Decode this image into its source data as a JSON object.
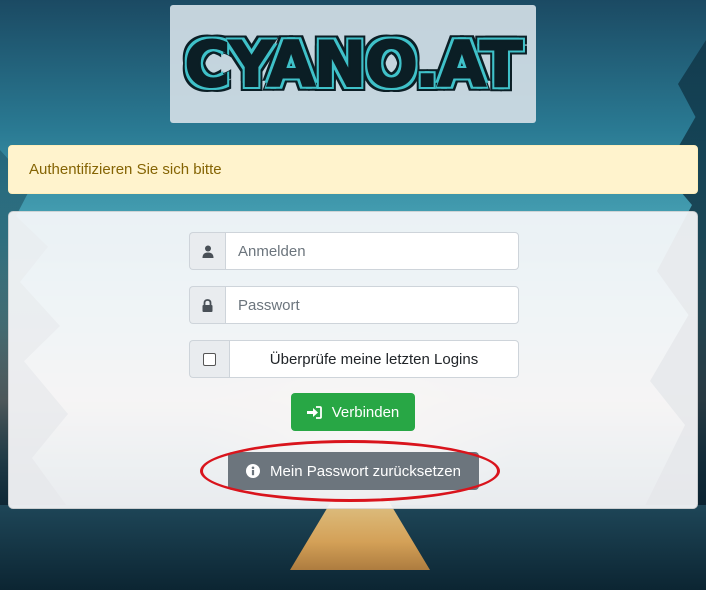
{
  "logo": {
    "text": "CYANO.AT"
  },
  "alert": {
    "message": "Authentifizieren Sie sich bitte"
  },
  "login_form": {
    "username": {
      "placeholder": "Anmelden",
      "value": "",
      "icon": "user-icon"
    },
    "password": {
      "placeholder": "Passwort",
      "value": "",
      "icon": "lock-icon"
    },
    "check_logins": {
      "label": "Überprüfe meine letzten Logins",
      "checked": false
    },
    "connect_button": {
      "label": "Verbinden",
      "icon": "sign-in-icon"
    },
    "reset_button": {
      "label": "Mein Passwort zurücksetzen",
      "icon": "info-circle-icon"
    }
  },
  "colors": {
    "success": "#28a745",
    "secondary": "#6c757d",
    "alert_bg": "#fff3cd",
    "alert_text": "#856404",
    "highlight": "#d9141c"
  }
}
